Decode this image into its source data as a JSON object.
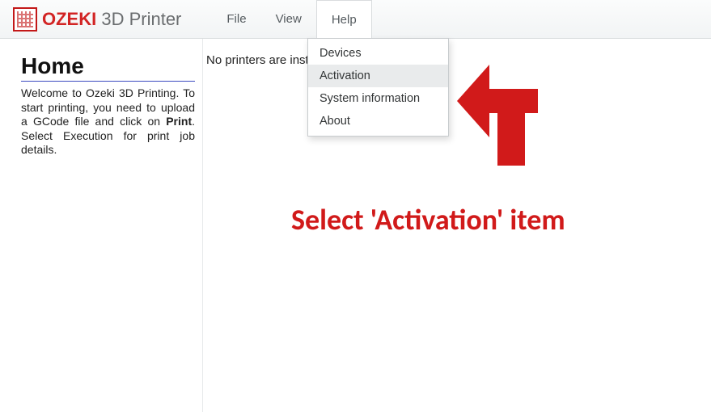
{
  "brand": {
    "strong": "OZEKI",
    "rest": " 3D Printer"
  },
  "menubar": {
    "file": "File",
    "view": "View",
    "help": "Help"
  },
  "help_menu": {
    "devices": "Devices",
    "activation": "Activation",
    "sysinfo": "System information",
    "about": "About"
  },
  "sidebar": {
    "title": "Home",
    "welcome_1": "Welcome to Ozeki 3D Printing. To start printing, you need to upload a GCode file and click on ",
    "welcome_print": "Print",
    "welcome_2": ". Select Execution for print job details."
  },
  "main": {
    "status": "No printers are installed"
  },
  "annotation": {
    "caption": "Select 'Activation' item"
  },
  "colors": {
    "accent_red": "#d11a1a",
    "menu_hover": "#e9ebec"
  }
}
